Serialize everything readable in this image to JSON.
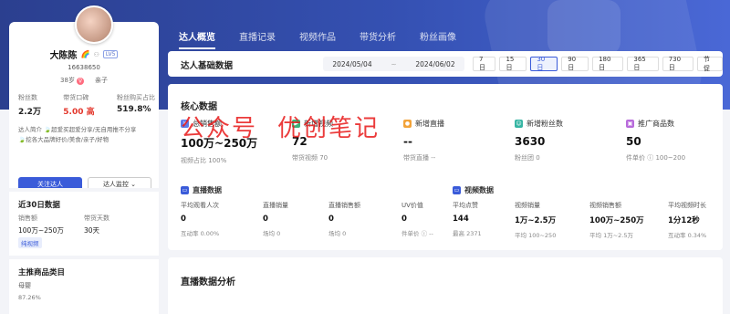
{
  "tabs": [
    {
      "label": "达人概览",
      "active": true
    },
    {
      "label": "直播记录",
      "active": false
    },
    {
      "label": "视频作品",
      "active": false
    },
    {
      "label": "带货分析",
      "active": false
    },
    {
      "label": "粉丝画像",
      "active": false
    }
  ],
  "profile": {
    "name": "大陈陈",
    "name_emoji": "🌈",
    "level": "LV5",
    "uid": "16638650",
    "age": "38岁",
    "gender_icon": "♀",
    "category": "亲子",
    "stats": [
      {
        "label": "粉丝数",
        "value": "2.2万"
      },
      {
        "label": "带货口碑",
        "value": "5.00 高"
      },
      {
        "label": "粉丝购买占比",
        "value": "519.8%"
      }
    ],
    "intro_label": "达人简介",
    "intro_lines": [
      "🍃超爱买超爱分享/无自用推不分享",
      "🍃挖各大品牌好价/美食/亲子/好物"
    ],
    "follow_button": "关注达人",
    "monitor_button": "达人监控"
  },
  "last30": {
    "title": "近30日数据",
    "sales_label": "销售额",
    "sales_value": "100万~250万",
    "days_label": "带货天数",
    "days_value": "30天",
    "tag": "纯视频"
  },
  "category": {
    "title": "主推商品类目",
    "name": "母婴",
    "pct": "87.26%"
  },
  "filter": {
    "title": "达人基础数据",
    "date_start": "2024/05/04",
    "date_sep": "~",
    "date_end": "2024/06/02",
    "periods": [
      "7日",
      "15日",
      "30日",
      "90日",
      "180日",
      "365日",
      "730日",
      "节促"
    ],
    "active_period": "30日"
  },
  "core": {
    "title": "核心数据",
    "kpis": [
      {
        "label": "总销售额",
        "value": "100万~250万",
        "sub": "视频占比 100%",
        "icon": "sales-icon",
        "color": "#5b7bea"
      },
      {
        "label": "新增视频",
        "value": "72",
        "sub": "带货视频 70",
        "icon": "video-icon",
        "color": "#3cb37a"
      },
      {
        "label": "新增直播",
        "value": "--",
        "sub": "带货直播 --",
        "icon": "live-icon",
        "color": "#f2a33a"
      },
      {
        "label": "新增粉丝数",
        "value": "3630",
        "sub": "粉丝团 0",
        "icon": "fans-icon",
        "color": "#36b5a3"
      },
      {
        "label": "推广商品数",
        "value": "50",
        "sub": "件单价 ⓘ 100~200",
        "icon": "goods-icon",
        "color": "#b86bdb"
      }
    ],
    "live_section": {
      "title": "直播数据",
      "cells": [
        {
          "label": "平均观看人次",
          "value": "0",
          "sub": "互动率 0.00%"
        },
        {
          "label": "直播销量",
          "value": "0",
          "sub": "场均 0"
        },
        {
          "label": "直播销售额",
          "value": "0",
          "sub": "场均 0"
        },
        {
          "label": "UV价值",
          "value": "0",
          "sub": "件单价 ⓘ --"
        }
      ]
    },
    "video_section": {
      "title": "视频数据",
      "cells": [
        {
          "label": "平均点赞",
          "value": "144",
          "sub": "最高 2371"
        },
        {
          "label": "视频销量",
          "value": "1万~2.5万",
          "sub": "平均 100~250"
        },
        {
          "label": "视频销售额",
          "value": "100万~250万",
          "sub": "平均 1万~2.5万"
        },
        {
          "label": "平均视频时长",
          "value": "1分12秒",
          "sub": "互动率 0.34%"
        }
      ]
    }
  },
  "live_analysis": {
    "title": "直播数据分析"
  },
  "watermark": {
    "left": "公众号",
    "right": "优创笔记"
  }
}
